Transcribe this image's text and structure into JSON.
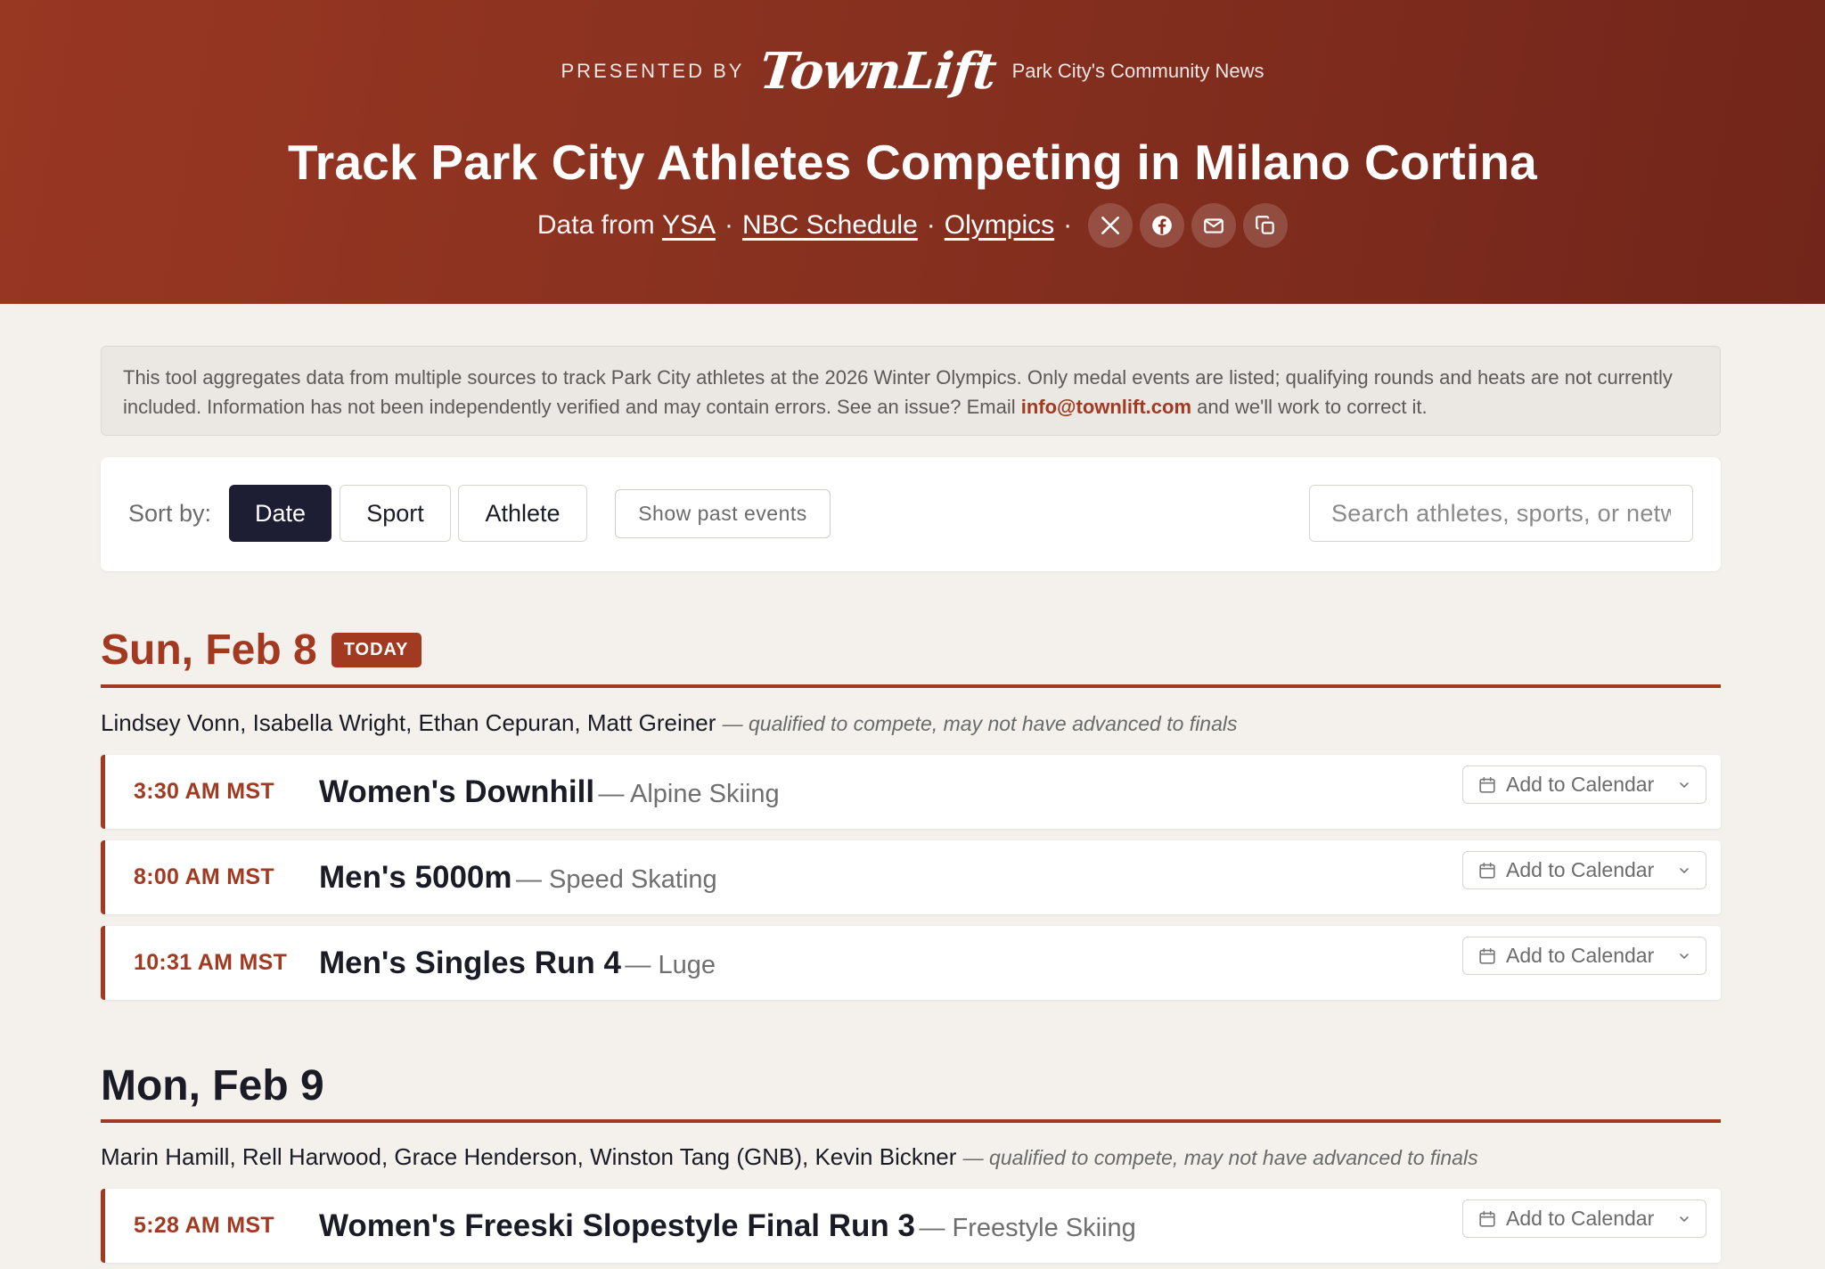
{
  "header": {
    "presented_by": "PRESENTED BY",
    "logo_text": "TownLift",
    "tagline": "Park City's Community News",
    "title": "Track Park City Athletes Competing in Milano Cortina",
    "sources_prefix": "Data from",
    "source_links": [
      "YSA",
      "NBC Schedule",
      "Olympics"
    ],
    "separator": "·",
    "share_icons": [
      "x-icon",
      "facebook-icon",
      "mail-icon",
      "copy-icon"
    ]
  },
  "notice": {
    "text_before": "This tool aggregates data from multiple sources to track Park City athletes at the 2026 Winter Olympics. Only medal events are listed; qualifying rounds and heats are not currently included. Information has not been independently verified and may contain errors. See an issue? Email ",
    "email": "info@townlift.com",
    "text_after": " and we'll work to correct it."
  },
  "controls": {
    "sort_label": "Sort by:",
    "sort_options": [
      "Date",
      "Sport",
      "Athlete"
    ],
    "active_sort": "Date",
    "past_events_label": "Show past events",
    "search_placeholder": "Search athletes, sports, or network...",
    "search_value": ""
  },
  "days": [
    {
      "date": "Sun, Feb 8",
      "badge": "TODAY",
      "athletes": "Lindsey Vonn, Isabella Wright, Ethan Cepuran, Matt Greiner",
      "note": "— qualified to compete, may not have advanced to finals",
      "events": [
        {
          "time": "3:30 AM MST",
          "name": "Women's Downhill",
          "sport": "— Alpine Skiing"
        },
        {
          "time": "8:00 AM MST",
          "name": "Men's 5000m",
          "sport": "— Speed Skating"
        },
        {
          "time": "10:31 AM MST",
          "name": "Men's Singles Run 4",
          "sport": "— Luge"
        }
      ]
    },
    {
      "date": "Mon, Feb 9",
      "athletes": "Marin Hamill, Rell Harwood, Grace Henderson, Winston Tang (GNB), Kevin Bickner",
      "note": "— qualified to compete, may not have advanced to finals",
      "events": [
        {
          "time": "5:28 AM MST",
          "name": "Women's Freeski Slopestyle Final Run 3",
          "sport": "— Freestyle Skiing"
        }
      ]
    }
  ],
  "calendar_button_label": "Add to Calendar",
  "colors": {
    "brand_red": "#a23a22",
    "header_gradient_start": "#983722",
    "header_gradient_end": "#72251a",
    "active_button": "#1d1d33",
    "page_background": "#f4f1ec"
  }
}
